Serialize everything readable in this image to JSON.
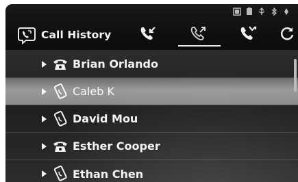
{
  "header": {
    "title": "Call History"
  },
  "status_bar": {
    "icons": [
      "signal-icon",
      "battery-icon",
      "usb-icon",
      "bluetooth-icon",
      "settings-icon"
    ]
  },
  "tabs": [
    {
      "icon": "incoming-call-icon",
      "active": false
    },
    {
      "icon": "outgoing-call-icon",
      "active": true
    },
    {
      "icon": "missed-call-icon",
      "active": false
    },
    {
      "icon": "refresh-icon",
      "active": false
    }
  ],
  "contacts": [
    {
      "name": "Brian Orlando",
      "type": "landline-phone-icon",
      "selected": false
    },
    {
      "name": "Caleb K",
      "type": "mobile-phone-icon",
      "selected": true
    },
    {
      "name": "David Mou",
      "type": "mobile-phone-icon",
      "selected": false
    },
    {
      "name": "Esther Cooper",
      "type": "landline-phone-icon",
      "selected": false
    },
    {
      "name": "Ethan Chen",
      "type": "mobile-phone-icon",
      "selected": false
    }
  ],
  "colors": {
    "background": "#222222",
    "selected_row": "#8a8a8a",
    "text": "#f4f4f4"
  }
}
